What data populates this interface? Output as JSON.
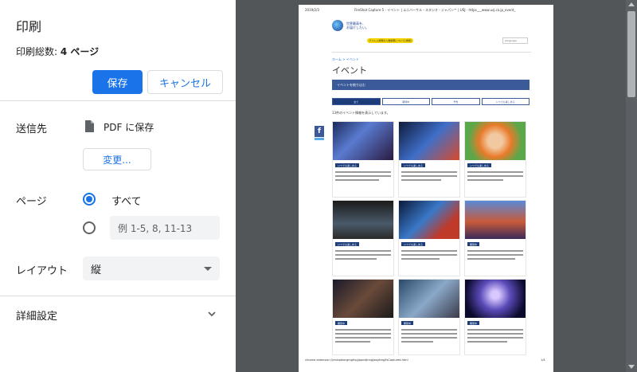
{
  "dialog": {
    "title": "印刷",
    "total_label": "印刷総数: ",
    "total_value": "4 ページ",
    "save_label": "保存",
    "cancel_label": "キャンセル",
    "accent_color": "#1a73e8"
  },
  "destination": {
    "label": "送信先",
    "value": "PDF に保存",
    "change_label": "変更..."
  },
  "pages": {
    "label": "ページ",
    "option_all": "すべて",
    "option_custom_placeholder": "例 1-5, 8, 11-13",
    "selected": "all"
  },
  "layout": {
    "label": "レイアウト",
    "selected": "縦"
  },
  "advanced": {
    "label": "詳細設定"
  },
  "preview": {
    "header_date": "2019/2/3",
    "header_title": "FireShot Capture 5 - イベント | ユニバーサル・スタジオ・ジャパン™ | USJ - https___www.usj.co.jp_event_",
    "logo_text": "世界最高を、\nお届けしたい。",
    "pill_text": "ゲスト入場時の人数制限について(詳細)",
    "lang_text": "Language",
    "breadcrumb": "ホーム > イベント",
    "page_heading": "イベント",
    "banner_text": "イベントを絞り込む",
    "tabs": [
      "全て",
      "期間中",
      "予告",
      "いつでも楽しめる"
    ],
    "count_text": "13件のイベント情報を表示しています。",
    "tags": [
      "いつでも楽しめる",
      "いつでも楽しめる",
      "いつでも楽しめる",
      "いつでも楽しめる",
      "いつでも楽しめる",
      "期間中",
      "期間中",
      "期間中",
      "期間中"
    ],
    "footer_left": "chrome-extension://mcbpblocgmgfnpjjppndjkmgjaogfceg/fsCaptured.html",
    "footer_right": "1/4"
  }
}
